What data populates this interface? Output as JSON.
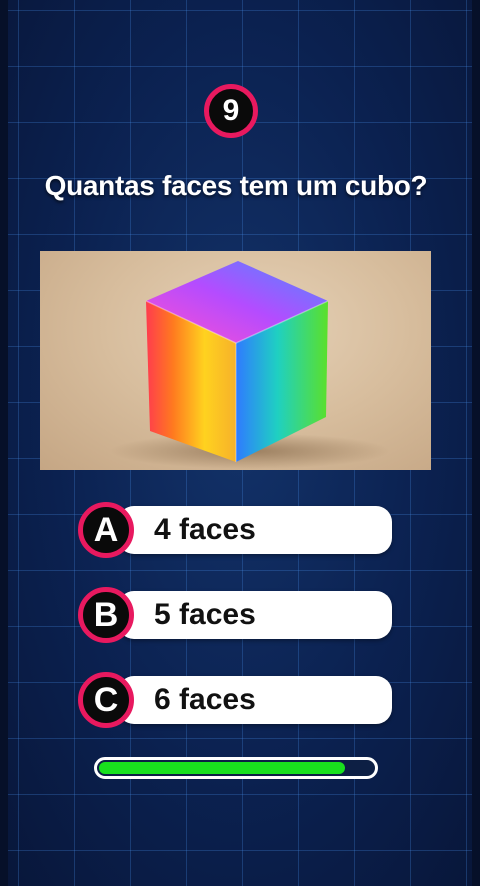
{
  "question": {
    "number": "9",
    "text": "Quantas faces tem um cubo?"
  },
  "image": {
    "subject": "rainbow-cube"
  },
  "options": [
    {
      "letter": "A",
      "label": "4 faces"
    },
    {
      "letter": "B",
      "label": "5 faces"
    },
    {
      "letter": "C",
      "label": "6 faces"
    }
  ],
  "timer": {
    "progress": 0.9
  },
  "colors": {
    "accent": "#e8195f",
    "progress": "#19e01e",
    "background": "#0b2150"
  }
}
